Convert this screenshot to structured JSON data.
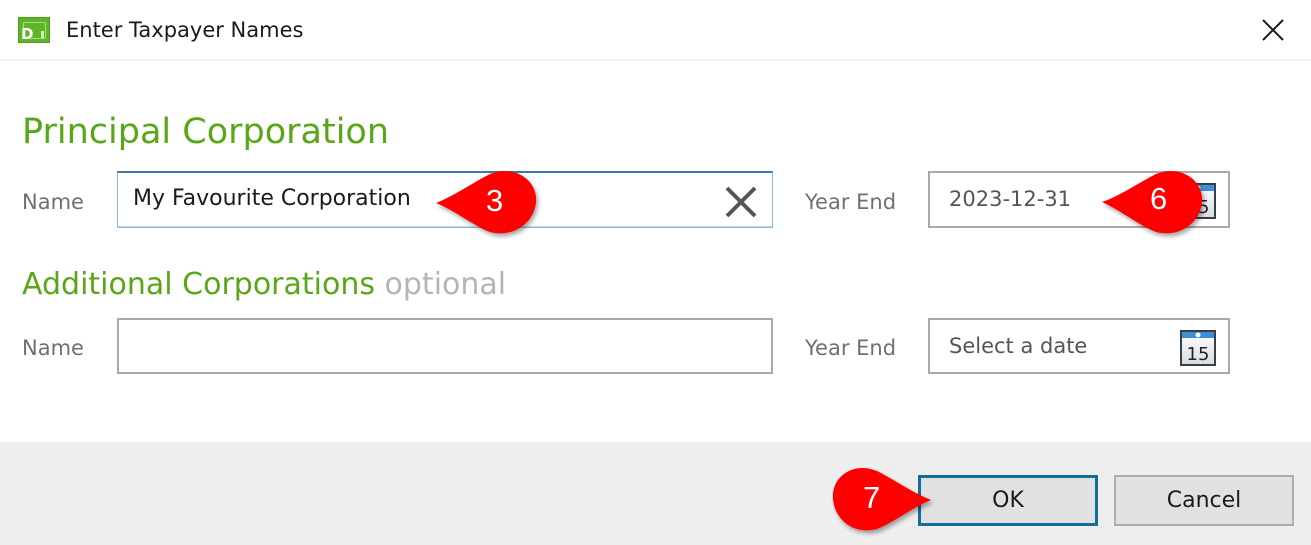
{
  "window": {
    "title": "Enter Taxpayer Names",
    "app_icon": "dt-app-icon",
    "close_icon": "close-icon"
  },
  "principal": {
    "heading": "Principal Corporation",
    "name_label": "Name",
    "name_value": "My Favourite Corporation",
    "name_clear_icon": "clear-x-icon",
    "year_end_label": "Year End",
    "year_end_value": "2023-12-31",
    "calendar_icon_day": "15"
  },
  "additional": {
    "heading": "Additional Corporations",
    "optional_label": "optional",
    "name_label": "Name",
    "name_value": "",
    "year_end_label": "Year End",
    "year_end_placeholder": "Select a date",
    "calendar_icon_day": "15"
  },
  "footer": {
    "ok_label": "OK",
    "cancel_label": "Cancel"
  },
  "annotations": [
    {
      "number": "3",
      "points_to": "principal-name-field"
    },
    {
      "number": "6",
      "points_to": "principal-year-end-field"
    },
    {
      "number": "7",
      "points_to": "ok-button"
    }
  ],
  "colors": {
    "accent_green": "#5aa619",
    "focus_blue": "#3f78a8",
    "default_button_border": "#0f6f9a",
    "marker_red": "#ff0000"
  }
}
